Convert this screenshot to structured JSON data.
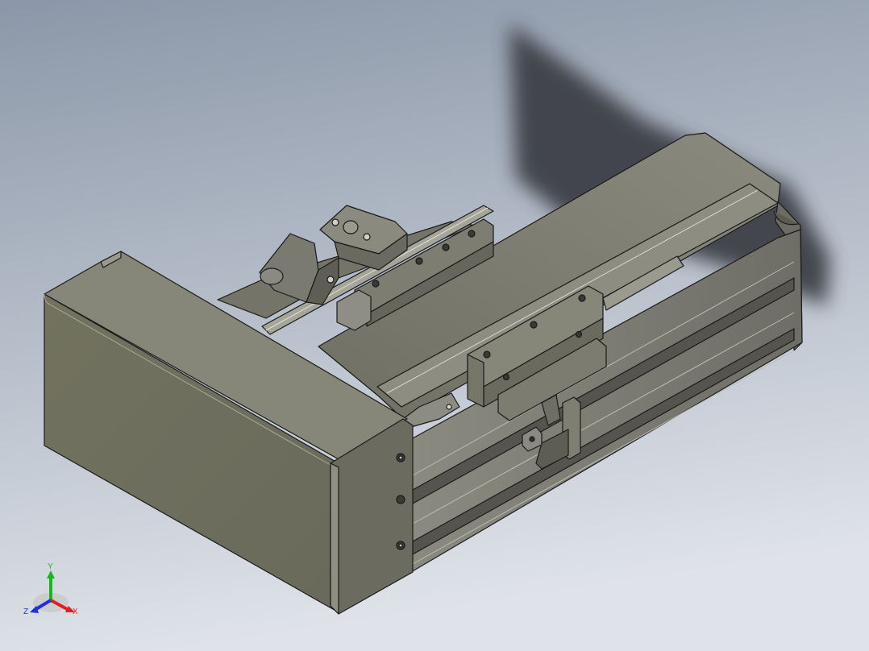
{
  "viewport": {
    "background_top": "#8b97a8",
    "background_bottom": "#dfe3e9"
  },
  "model": {
    "body_color": "#7e7e72",
    "edge_color": "#1a1a1a",
    "shadow_color": "#3d4147"
  },
  "triad": {
    "x_label": "X",
    "y_label": "Y",
    "z_label": "Z",
    "x_color": "#e02020",
    "y_color": "#18b818",
    "z_color": "#2030e0"
  }
}
